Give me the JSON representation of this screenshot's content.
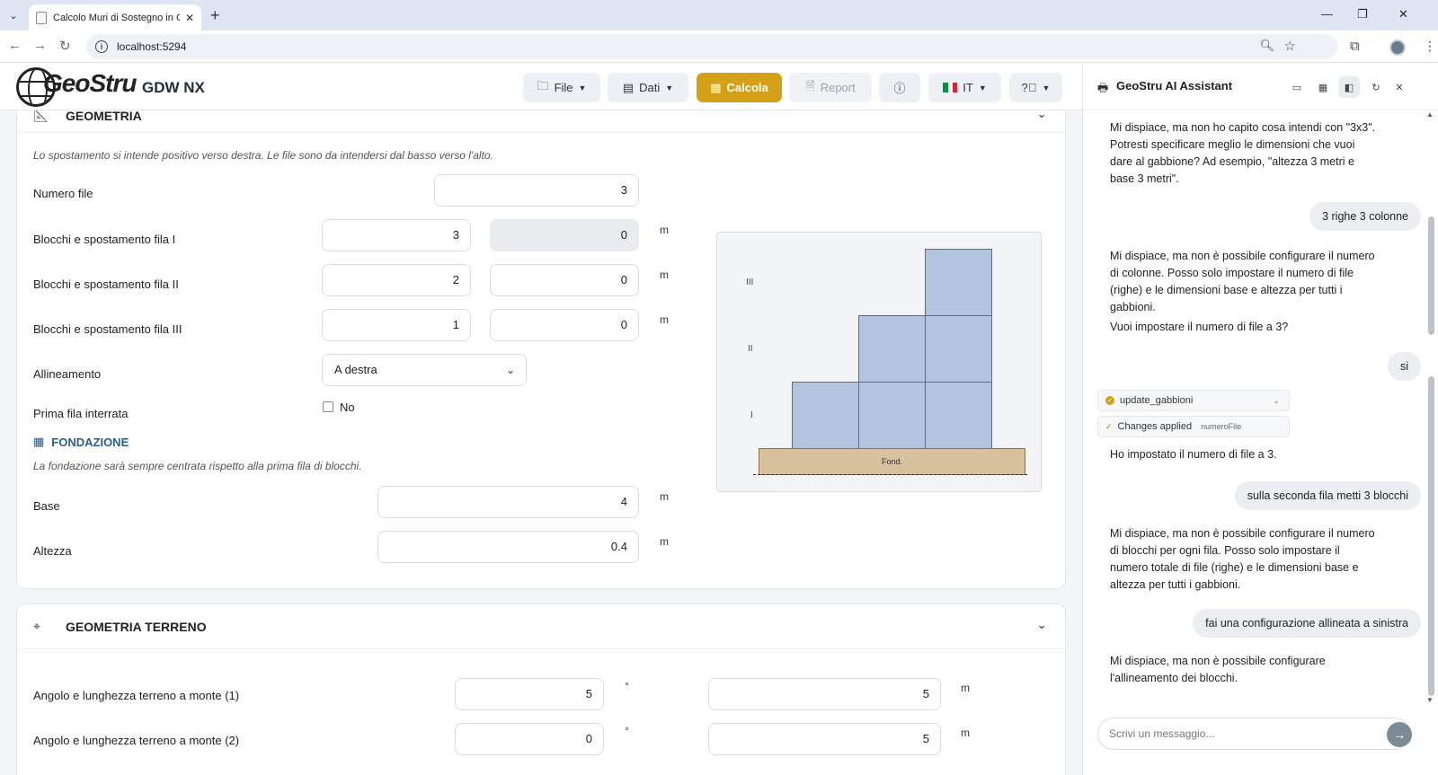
{
  "browser": {
    "tab_title": "Calcolo Muri di Sostegno in Gabbioni",
    "url": "localhost:5294"
  },
  "header": {
    "brand": "GeoStru",
    "product": "GDW NX",
    "menu": {
      "file": "File",
      "dati": "Dati",
      "calcola": "Calcola",
      "report": "Report",
      "lang": "IT"
    }
  },
  "geometria": {
    "title": "GEOMETRIA",
    "note": "Lo spostamento si intende positivo verso destra. Le file sono da intendersi dal basso verso l'alto.",
    "numero_file": {
      "label": "Numero file",
      "value": "3"
    },
    "rows": [
      {
        "label": "Blocchi e spostamento fila I",
        "blocks": "3",
        "offset": "0",
        "unit": "m"
      },
      {
        "label": "Blocchi e spostamento fila II",
        "blocks": "2",
        "offset": "0",
        "unit": "m"
      },
      {
        "label": "Blocchi e spostamento fila III",
        "blocks": "1",
        "offset": "0",
        "unit": "m"
      }
    ],
    "allineamento": {
      "label": "Allineamento",
      "value": "A destra"
    },
    "prima_fila": {
      "label": "Prima fila interrata",
      "value": "No"
    },
    "fondazione": {
      "title": "FONDAZIONE",
      "note": "La fondazione sarà sempre centrata rispetto alla prima fila di blocchi.",
      "base": {
        "label": "Base",
        "value": "4",
        "unit": "m"
      },
      "altezza": {
        "label": "Altezza",
        "value": "0.4",
        "unit": "m"
      }
    },
    "preview": {
      "row_labels": [
        "III",
        "II",
        "I"
      ],
      "foundation_label": "Fond.",
      "blocks_per_row": [
        3,
        2,
        1
      ]
    }
  },
  "terreno": {
    "title": "GEOMETRIA TERRENO",
    "rows": [
      {
        "label": "Angolo e lunghezza terreno a monte (1)",
        "angle": "5",
        "angle_unit": "°",
        "length": "5",
        "length_unit": "m"
      },
      {
        "label": "Angolo e lunghezza terreno a monte (2)",
        "angle": "0",
        "angle_unit": "°",
        "length": "5",
        "length_unit": "m"
      }
    ]
  },
  "assistant": {
    "title": "GeoStru AI Assistant",
    "messages": [
      {
        "role": "ai",
        "text": "Mi dispiace, ma non ho capito cosa intendi con \"3x3\". Potresti specificare meglio le dimensioni che vuoi dare al gabbione? Ad esempio, \"altezza 3 metri e base 3 metri\"."
      },
      {
        "role": "user",
        "text": "3 righe 3 colonne"
      },
      {
        "role": "ai",
        "text": "Mi dispiace, ma non è possibile configurare il numero di colonne. Posso solo impostare il numero di file (righe) e le dimensioni base e altezza per tutti i gabbioni."
      },
      {
        "role": "ai",
        "text": "Vuoi impostare il numero di file a 3?"
      },
      {
        "role": "user",
        "text": "si"
      },
      {
        "role": "tool",
        "text": "update_gabbioni"
      },
      {
        "role": "tool",
        "text": "Changes applied",
        "detail": "numeroFile"
      },
      {
        "role": "ai",
        "text": "Ho impostato il numero di file a 3."
      },
      {
        "role": "user",
        "text": "sulla seconda fila metti 3 blocchi"
      },
      {
        "role": "ai",
        "text": "Mi dispiace, ma non è possibile configurare il numero di blocchi per ogni fila. Posso solo impostare il numero totale di file (righe) e le dimensioni base e altezza per tutti i gabbioni."
      },
      {
        "role": "user",
        "text": "fai una configurazione allineata a sinistra"
      },
      {
        "role": "ai",
        "text": "Mi dispiace, ma non è possibile configurare l'allineamento dei blocchi."
      }
    ],
    "input_placeholder": "Scrivi un messaggio..."
  }
}
